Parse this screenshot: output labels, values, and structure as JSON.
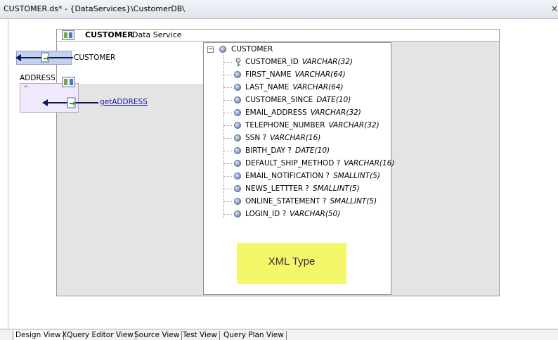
{
  "window": {
    "title": "CUSTOMER.ds* - {DataServices}\\CustomerDB\\",
    "close_glyph": "×"
  },
  "data_service": {
    "name": "CUSTOMER",
    "label": "Data Service"
  },
  "left": {
    "customer_label": "CUSTOMER",
    "address_label": "ADDRESS",
    "get_link": "getADDRESS",
    "collapse_glyph": "^"
  },
  "tree": {
    "root_toggle": "−",
    "root": "CUSTOMER",
    "fields": [
      {
        "name": "CUSTOMER_ID",
        "type": "VARCHAR(32)",
        "icon": "key-icon"
      },
      {
        "name": "FIRST_NAME",
        "type": "VARCHAR(64)",
        "icon": "element-icon"
      },
      {
        "name": "LAST_NAME",
        "type": "VARCHAR(64)",
        "icon": "element-icon"
      },
      {
        "name": "CUSTOMER_SINCE",
        "type": "DATE(10)",
        "icon": "element-icon"
      },
      {
        "name": "EMAIL_ADDRESS",
        "type": "VARCHAR(32)",
        "icon": "element-icon"
      },
      {
        "name": "TELEPHONE_NUMBER",
        "type": "VARCHAR(32)",
        "icon": "element-icon"
      },
      {
        "name": "SSN ?",
        "type": "VARCHAR(16)",
        "icon": "element-icon"
      },
      {
        "name": "BIRTH_DAY ?",
        "type": "DATE(10)",
        "icon": "element-icon"
      },
      {
        "name": "DEFAULT_SHIP_METHOD ?",
        "type": "VARCHAR(16)",
        "icon": "element-icon"
      },
      {
        "name": "EMAIL_NOTIFICATION ?",
        "type": "SMALLINT(5)",
        "icon": "element-icon"
      },
      {
        "name": "NEWS_LETTTER ?",
        "type": "SMALLINT(5)",
        "icon": "element-icon"
      },
      {
        "name": "ONLINE_STATEMENT ?",
        "type": "SMALLINT(5)",
        "icon": "element-icon"
      },
      {
        "name": "LOGIN_ID ?",
        "type": "VARCHAR(50)",
        "icon": "element-icon"
      }
    ]
  },
  "annotation": "XML Type",
  "tabs": [
    {
      "label": "Design View",
      "active": true
    },
    {
      "label": "XQuery Editor View",
      "active": false
    },
    {
      "label": "Source View",
      "active": false
    },
    {
      "label": "Test View",
      "active": false
    },
    {
      "label": "Query Plan View",
      "active": false
    }
  ]
}
